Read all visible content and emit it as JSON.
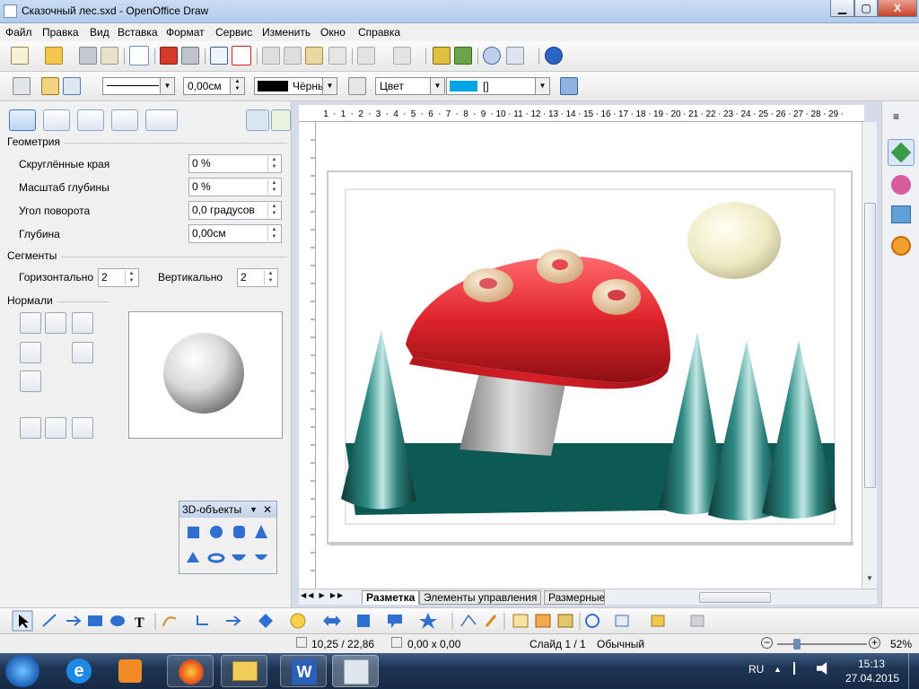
{
  "window": {
    "title": "Сказочный лес.sxd - OpenOffice Draw",
    "min": "▁",
    "max": "▢",
    "close": "X"
  },
  "menu": [
    "Файл",
    "Правка",
    "Вид",
    "Вставка",
    "Формат",
    "Сервис",
    "Изменить",
    "Окно",
    "Справка"
  ],
  "linebar": {
    "line_width": "0,00см",
    "line_color": "Чёрнь",
    "area_style": "Цвет",
    "area_color": "[]"
  },
  "panel": {
    "geometry_label": "Геометрия",
    "rows": [
      {
        "label": "Скруглённые края",
        "value": "0 %"
      },
      {
        "label": "Масштаб глубины",
        "value": "0 %"
      },
      {
        "label": "Угол поворота",
        "value": "0,0 градусов"
      },
      {
        "label": "Глубина",
        "value": "0,00см"
      }
    ],
    "segments_label": "Сегменты",
    "horizontal_label": "Горизонтально",
    "horizontal_value": "2",
    "vertical_label": "Вертикально",
    "vertical_value": "2",
    "normals_label": "Нормали"
  },
  "float3d": {
    "title": "3D-объекты",
    "close": "✕"
  },
  "ruler": {
    "h_ticks": [
      "1",
      "1",
      "2",
      "3",
      "4",
      "5",
      "6",
      "7",
      "8",
      "9",
      "10",
      "11",
      "12",
      "13",
      "14",
      "15",
      "16",
      "17",
      "18",
      "19",
      "20",
      "21",
      "22",
      "23",
      "24",
      "25",
      "26",
      "27",
      "28",
      "29"
    ]
  },
  "tabs": [
    "Разметка",
    "Элементы управления",
    "Размерные"
  ],
  "status": {
    "position": "10,25 / 22,86",
    "size": "0,00 x 0,00",
    "slide": "Слайд 1 / 1",
    "style": "Обычный",
    "zoom": "52%"
  },
  "taskbar": {
    "lang": "RU",
    "time": "15:13",
    "date": "27.04.2015"
  },
  "colors": {
    "line_color": "#000000",
    "area_color": "#00a6e8",
    "mushroom_red": "#e0232b",
    "ground": "#0d5a55"
  }
}
